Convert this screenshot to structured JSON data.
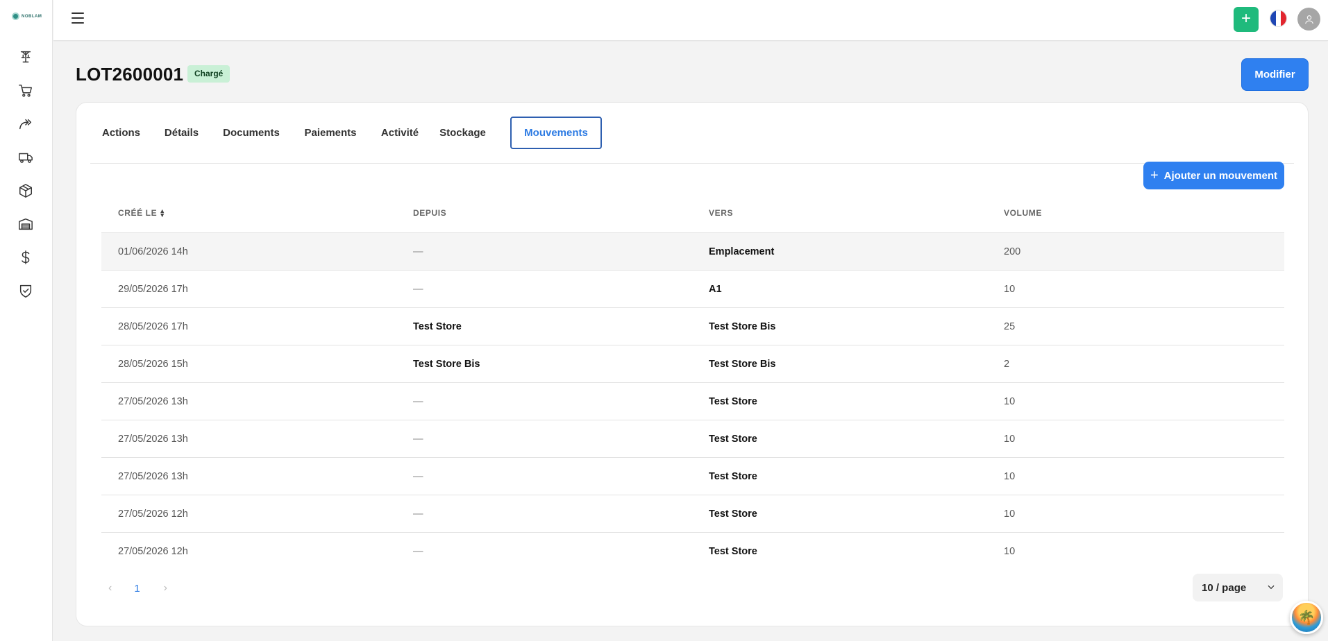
{
  "app": {
    "logo_text": "NOBLAM"
  },
  "sidebar": {
    "items": [
      {
        "icon": "crane-icon"
      },
      {
        "icon": "cart-icon"
      },
      {
        "icon": "forward-arrows-icon"
      },
      {
        "icon": "truck-icon"
      },
      {
        "icon": "package-icon"
      },
      {
        "icon": "warehouse-icon"
      },
      {
        "icon": "dollar-icon"
      },
      {
        "icon": "shield-check-icon"
      }
    ]
  },
  "topbar": {
    "add_label": "+",
    "language_flag": "fr-flag-icon",
    "avatar_icon": "user-icon"
  },
  "header": {
    "title": "LOT2600001",
    "status_badge": "Chargé",
    "edit_button": "Modifier"
  },
  "tabs": [
    {
      "label": "Actions"
    },
    {
      "label": "Détails"
    },
    {
      "label": "Documents"
    },
    {
      "label": "Paiements"
    },
    {
      "label": "Activité"
    },
    {
      "label": "Stockage"
    },
    {
      "label": "Mouvements",
      "active": true
    }
  ],
  "add_movement_button": {
    "icon": "+",
    "label": "Ajouter un mouvement"
  },
  "table": {
    "columns": [
      "CRÉÉ LE",
      "DEPUIS",
      "VERS",
      "VOLUME"
    ],
    "rows": [
      {
        "created": "01/06/2026 14h",
        "from": "—",
        "to": "Emplacement",
        "volume": "200"
      },
      {
        "created": "29/05/2026 17h",
        "from": "—",
        "to": "A1",
        "volume": "10"
      },
      {
        "created": "28/05/2026 17h",
        "from": "Test Store",
        "to": "Test Store Bis",
        "volume": "25"
      },
      {
        "created": "28/05/2026 15h",
        "from": "Test Store Bis",
        "to": "Test Store Bis",
        "volume": "2"
      },
      {
        "created": "27/05/2026 13h",
        "from": "—",
        "to": "Test Store",
        "volume": "10"
      },
      {
        "created": "27/05/2026 13h",
        "from": "—",
        "to": "Test Store",
        "volume": "10"
      },
      {
        "created": "27/05/2026 13h",
        "from": "—",
        "to": "Test Store",
        "volume": "10"
      },
      {
        "created": "27/05/2026 12h",
        "from": "—",
        "to": "Test Store",
        "volume": "10"
      },
      {
        "created": "27/05/2026 12h",
        "from": "—",
        "to": "Test Store",
        "volume": "10"
      }
    ]
  },
  "pagination": {
    "prev": "‹",
    "current_page": "1",
    "next": "›",
    "page_size": "10 / page"
  },
  "colors": {
    "primary": "#2f80f0",
    "success": "#1fba7c",
    "badge_bg": "#c9f0d6"
  }
}
